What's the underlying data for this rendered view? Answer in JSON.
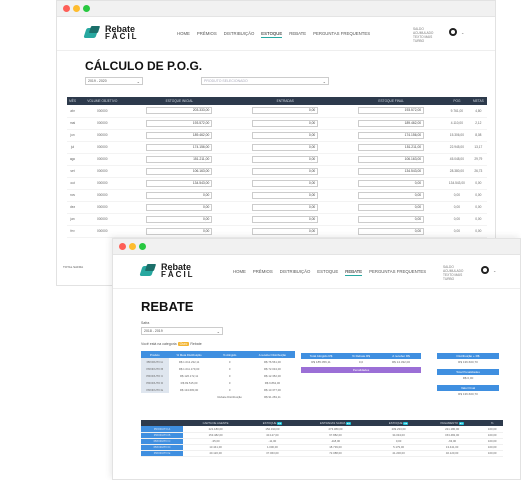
{
  "window1": {
    "logo": {
      "line1": "Rebate",
      "line2": "FÁCIL"
    },
    "menu": [
      "HOME",
      "PRÊMIOS",
      "DISTRIBUIÇÃO",
      "ESTOQUE",
      "REBATE",
      "PERGUNTAS FREQUENTES"
    ],
    "saldo": [
      "SALDO",
      "ACUMULADO",
      "TEXTO MAIS",
      "TURBO"
    ],
    "title": "CÁLCULO DE P.O.G.",
    "period_select": "2019 - 2020",
    "product_select": "PRODUTO SELECIONADO",
    "table": {
      "headers": [
        "MÊS",
        "VOLUME OBJETIVO",
        "ESTOQUE INICIAL",
        "ENTRADAS",
        "ESTOQUE FINAL",
        "POG",
        "METAS"
      ],
      "rows": [
        {
          "mes": "abr",
          "vol": "000000",
          "ini": "203.333,00",
          "ent": "0,00",
          "fin": "193.572,00",
          "pog": "9.761,00",
          "meta": "4,80"
        },
        {
          "mes": "mai",
          "vol": "000000",
          "ini": "193.572,00",
          "ent": "0,00",
          "fin": "189.462,00",
          "pog": "4.110,00",
          "meta": "2,12"
        },
        {
          "mes": "jun",
          "vol": "000000",
          "ini": "189.462,00",
          "ent": "0,00",
          "fin": "174.156,00",
          "pog": "15.306,00",
          "meta": "8,08"
        },
        {
          "mes": "jul",
          "vol": "000000",
          "ini": "174.156,00",
          "ent": "0,00",
          "fin": "151.211,00",
          "pog": "22.945,00",
          "meta": "13,17"
        },
        {
          "mes": "ago",
          "vol": "000000",
          "ini": "151.211,00",
          "ent": "0,00",
          "fin": "106.163,00",
          "pog": "45.048,00",
          "meta": "29,79"
        },
        {
          "mes": "set",
          "vol": "000000",
          "ini": "106.163,00",
          "ent": "0,00",
          "fin": "134.543,00",
          "pog": "28.380,00",
          "meta": "26,73"
        },
        {
          "mes": "out",
          "vol": "000000",
          "ini": "134.543,00",
          "ent": "0,00",
          "fin": "0,00",
          "pog": "134.543,00",
          "meta": "0,00"
        },
        {
          "mes": "nov",
          "vol": "000000",
          "ini": "0,00",
          "ent": "0,00",
          "fin": "0,00",
          "pog": "0,00",
          "meta": "0,00"
        },
        {
          "mes": "dez",
          "vol": "000000",
          "ini": "0,00",
          "ent": "0,00",
          "fin": "0,00",
          "pog": "0,00",
          "meta": "0,00"
        },
        {
          "mes": "jan",
          "vol": "000000",
          "ini": "0,00",
          "ent": "0,00",
          "fin": "0,00",
          "pog": "0,00",
          "meta": "0,00"
        },
        {
          "mes": "fev",
          "vol": "000000",
          "ini": "0,00",
          "ent": "0,00",
          "fin": "0,00",
          "pog": "0,00",
          "meta": "0,00"
        }
      ],
      "footer_label": "TOTAL SAFRA"
    }
  },
  "window2": {
    "logo": {
      "line1": "Rebate",
      "line2": "FÁCIL"
    },
    "menu": [
      "HOME",
      "PRÊMIOS",
      "DISTRIBUIÇÃO",
      "ESTOQUE",
      "REBATE",
      "PERGUNTAS FREQUENTES"
    ],
    "saldo": [
      "SALDO",
      "ACUMULADO",
      "TEXTO MAIS",
      "TURBO"
    ],
    "title": "REBATE",
    "safra_label": "Safra",
    "safra_select": "2018 - 2019",
    "category_text": "Você está na categoria",
    "category_badge": "Ouro",
    "category_suffix": "Rebate",
    "produto_table": {
      "headers": [
        "Produto",
        "% Meta Distribuição",
        "% Atingido",
        "A receber Distribuição"
      ],
      "rows": [
        [
          "PRODUTO A",
          "R$ 1.012.232,11",
          "0",
          "R$ 76.561,00"
        ],
        [
          "PRODUTO B",
          "R$ 1.011.179,00",
          "0",
          "R$ 72.034,00"
        ],
        [
          "PRODUTO C",
          "R$ 126.172,11",
          "0",
          "R$ 12.352,00"
        ],
        [
          "PRODUTO D",
          "R$ 99.515,00",
          "0",
          "R$ 9.862,00"
        ],
        [
          "PRODUTO E",
          "R$ 134.680,00",
          "0",
          "R$ 13.377,00"
        ]
      ],
      "total_label": "Rebate Distribuição",
      "total_value": "R$ 91.281,11"
    },
    "summary_headers": [
      "Total Atingido R$",
      "% Rebate R$",
      "A receber R$"
    ],
    "summary_values": [
      "R$ 185.056,11",
      "0,0",
      "R$ 14.332,00"
    ],
    "penalidades": "Penalidades",
    "right_cards": [
      {
        "title": "Distribuição + R$",
        "value": "R$ 136.600,70"
      },
      {
        "title": "Total Penalidades",
        "value": "R$ 0,00"
      },
      {
        "title": "Valor Final",
        "value": "R$ 136.600,70"
      }
    ],
    "stock_table": {
      "headers": [
        "CARTA DE AGENTE",
        "ESTOQUE",
        "ENTRADAS SAFRA",
        "ESTOQUE",
        "PAGAMENTO",
        "%"
      ],
      "rows": [
        [
          "PRODUTO A",
          "221.180,00",
          "152.190,00",
          "273.380,00",
          "209.233,00",
          "221.180,00",
          "100,00"
        ],
        [
          "PRODUTO B",
          "153.482,00",
          "40.127,00",
          "67.882,00",
          "34.034,00",
          "153.482,00",
          "100,00"
        ],
        [
          "PRODUTO C",
          "-35,00",
          "-11,00",
          "-118,00",
          "0,00",
          "-63,00",
          "100,00"
        ],
        [
          "PRODUTO D",
          "13.441,00",
          "1.000,00",
          "18.739,00",
          "5.179,00",
          "13.441,00",
          "100,00"
        ],
        [
          "PRODUTO E",
          "40.120,00",
          "37.063,00",
          "72.088,00",
          "41.200,00",
          "40.120,00",
          "100,00"
        ]
      ]
    }
  }
}
